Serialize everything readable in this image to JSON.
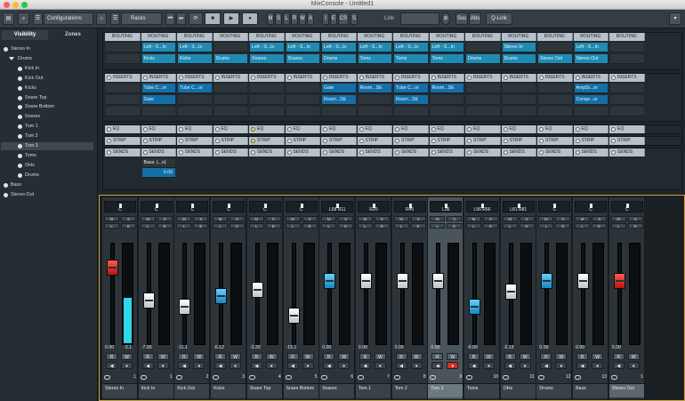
{
  "window": {
    "title": "MixConsole - Untitled1"
  },
  "toolbar": {
    "configurations_label": "Configurations",
    "racks_label": "Racks",
    "mode_letters": [
      "M",
      "S",
      "L",
      "R",
      "W",
      "A"
    ],
    "letters2": [
      "I",
      "E",
      "CS",
      "S"
    ],
    "link_label": "Link",
    "sus_label": "Sus",
    "abs_label": "Abs",
    "qlink_label": "Q-Link"
  },
  "left_panel": {
    "tabs": [
      "Visibility",
      "Zones"
    ],
    "items": [
      {
        "label": "Stereo In",
        "indent": 0,
        "type": "dot"
      },
      {
        "label": "Drums",
        "indent": 1,
        "type": "folder"
      },
      {
        "label": "Kick In",
        "indent": 2,
        "type": "dot"
      },
      {
        "label": "Kick Out",
        "indent": 2,
        "type": "dot"
      },
      {
        "label": "Kicks",
        "indent": 2,
        "type": "dot"
      },
      {
        "label": "Snare Top",
        "indent": 2,
        "type": "dot"
      },
      {
        "label": "Snare Bottom",
        "indent": 2,
        "type": "dot"
      },
      {
        "label": "Snares",
        "indent": 2,
        "type": "dot"
      },
      {
        "label": "Tom 1",
        "indent": 2,
        "type": "dot"
      },
      {
        "label": "Tom 2",
        "indent": 2,
        "type": "dot"
      },
      {
        "label": "Tom 3",
        "indent": 2,
        "type": "dot",
        "selected": true
      },
      {
        "label": "Toms",
        "indent": 2,
        "type": "dot"
      },
      {
        "label": "OHs",
        "indent": 2,
        "type": "dot"
      },
      {
        "label": "Drums",
        "indent": 2,
        "type": "dot"
      },
      {
        "label": "Bass",
        "indent": 0,
        "type": "dot"
      },
      {
        "label": "Stereo Out",
        "indent": 0,
        "type": "dot"
      }
    ]
  },
  "racks": {
    "routing": {
      "header": "ROUTING",
      "slot1": [
        "",
        "Left - S...In",
        "Left - S...In",
        "",
        "Left - S...In",
        "Left - S...In",
        "Left - S...In",
        "Left - S...In",
        "Left - S...In",
        "Left - S...In",
        "",
        "Stereo In",
        "",
        "Left - S...In",
        ""
      ],
      "slot2": [
        "",
        "Kicks",
        "Kicks",
        "Drums",
        "Snares",
        "Snares",
        "Drums",
        "Toms",
        "Toms",
        "Toms",
        "Drums",
        "Drums",
        "Stereo Out",
        "Stereo Out",
        ""
      ]
    },
    "inserts": {
      "header": "INSERTS",
      "slot1": [
        "",
        "Tube C...or",
        "Tube C...or",
        "",
        "",
        "",
        "Gate",
        "Room...SE",
        "Tube C...or",
        "Room...SE",
        "",
        "",
        "",
        "AmpSi...or",
        ""
      ],
      "slot2": [
        "",
        "Gate",
        "",
        "",
        "",
        "",
        "Room...SE",
        "",
        "Room...SE",
        "",
        "",
        "",
        "",
        "Compr...or",
        ""
      ]
    },
    "eq": {
      "header": "EQ",
      "active_index": 4
    },
    "strip": {
      "header": "STRIP",
      "active_index": 4
    },
    "sends": {
      "header": "SENDS",
      "slot1_label": "Bass: (...n)",
      "slot2_value": "0.00"
    }
  },
  "channels": [
    {
      "name": "Stereo In",
      "num": "1",
      "pan": "C",
      "volume": "0.00",
      "peak": "-3.1",
      "fader_level": 0.8,
      "meter_level": 0.45,
      "cap": "red"
    },
    {
      "name": "Kick In",
      "num": "1",
      "pan": "C",
      "volume": "-7.00",
      "peak": "",
      "fader_level": 0.42,
      "meter_level": 0.0,
      "cap": "white"
    },
    {
      "name": "Kick Out",
      "num": "2",
      "pan": "C",
      "volume": "-11.1",
      "peak": "",
      "fader_level": 0.35,
      "meter_level": 0.0,
      "cap": "white"
    },
    {
      "name": "Kicks",
      "num": "3",
      "pan": "C",
      "volume": "-6.12",
      "peak": "",
      "fader_level": 0.47,
      "meter_level": 0.0,
      "cap": "blue"
    },
    {
      "name": "Snare Top",
      "num": "4",
      "pan": "C",
      "volume": "-3.20",
      "peak": "",
      "fader_level": 0.55,
      "meter_level": 0.0,
      "cap": "white"
    },
    {
      "name": "Snare Bottom",
      "num": "5",
      "pan": "C",
      "volume": "-15.1",
      "peak": "",
      "fader_level": 0.25,
      "meter_level": 0.0,
      "cap": "white"
    },
    {
      "name": "Snares",
      "num": "6",
      "pan": "L58 R11",
      "volume": "0.00",
      "peak": "",
      "fader_level": 0.65,
      "meter_level": 0.0,
      "cap": "blue"
    },
    {
      "name": "Tom 1",
      "num": "7",
      "pan": "R20",
      "volume": "0.00",
      "peak": "",
      "fader_level": 0.65,
      "meter_level": 0.0,
      "cap": "white"
    },
    {
      "name": "Tom 2",
      "num": "8",
      "pan": "R45",
      "volume": "0.00",
      "peak": "",
      "fader_level": 0.65,
      "meter_level": 0.0,
      "cap": "white"
    },
    {
      "name": "Tom 3",
      "num": "9",
      "pan": "L36",
      "volume": "0.00",
      "peak": "",
      "fader_level": 0.65,
      "meter_level": 0.0,
      "cap": "white",
      "selected": true,
      "rec": true
    },
    {
      "name": "Toms",
      "num": "10",
      "pan": "L56 R56",
      "volume": "-9.00",
      "peak": "",
      "fader_level": 0.35,
      "meter_level": 0.0,
      "cap": "blue"
    },
    {
      "name": "OHs",
      "num": "11",
      "pan": "L81 R81",
      "volume": "-3.13",
      "peak": "",
      "fader_level": 0.53,
      "meter_level": 0.0,
      "cap": "white"
    },
    {
      "name": "Drums",
      "num": "12",
      "pan": "C",
      "volume": "0.00",
      "peak": "",
      "fader_level": 0.65,
      "meter_level": 0.0,
      "cap": "blue"
    },
    {
      "name": "Bass",
      "num": "13",
      "pan": "C",
      "volume": "0.00",
      "peak": "",
      "fader_level": 0.65,
      "meter_level": 0.0,
      "cap": "white"
    },
    {
      "name": "Stereo Out",
      "num": "1",
      "pan": "C",
      "volume": "0.00",
      "peak": "",
      "fader_level": 0.65,
      "meter_level": 0.0,
      "cap": "red",
      "output": true
    }
  ],
  "strip_button_labels": {
    "r": "R",
    "w": "W",
    "m": "M",
    "s": "S",
    "l": "L",
    "e": "E"
  }
}
